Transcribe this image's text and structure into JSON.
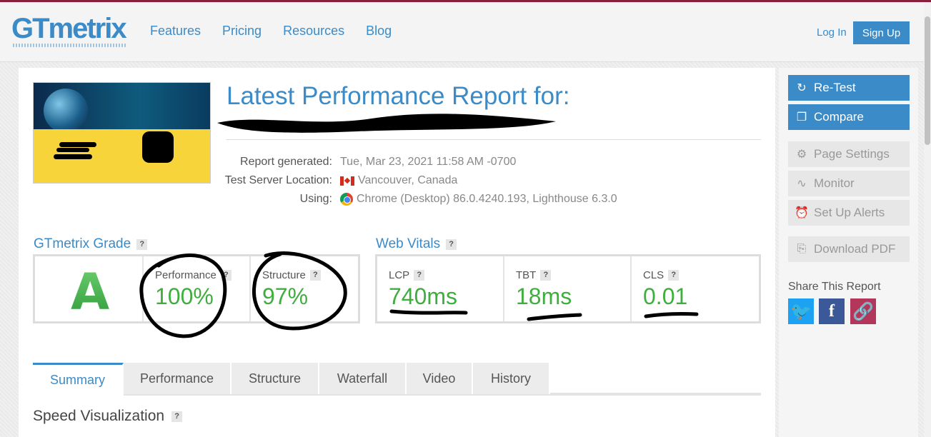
{
  "header": {
    "logo": "GTmetrix",
    "nav": [
      "Features",
      "Pricing",
      "Resources",
      "Blog"
    ],
    "login": "Log In",
    "signup": "Sign Up"
  },
  "report": {
    "title": "Latest Performance Report for:",
    "meta": [
      {
        "label": "Report generated:",
        "value": "Tue, Mar 23, 2021 11:58 AM -0700"
      },
      {
        "label": "Test Server Location:",
        "value": "Vancouver, Canada"
      },
      {
        "label": "Using:",
        "value": "Chrome (Desktop) 86.0.4240.193, Lighthouse 6.3.0"
      }
    ]
  },
  "grade": {
    "title": "GTmetrix Grade",
    "letter": "A",
    "performance_label": "Performance",
    "performance_value": "100%",
    "structure_label": "Structure",
    "structure_value": "97%"
  },
  "vitals": {
    "title": "Web Vitals",
    "items": [
      {
        "label": "LCP",
        "value": "740ms"
      },
      {
        "label": "TBT",
        "value": "18ms"
      },
      {
        "label": "CLS",
        "value": "0.01"
      }
    ]
  },
  "tabs": [
    "Summary",
    "Performance",
    "Structure",
    "Waterfall",
    "Video",
    "History"
  ],
  "speed_viz": "Speed Visualization",
  "help_mark": "?",
  "sidebar": {
    "buttons": [
      "Re-Test",
      "Compare",
      "Page Settings",
      "Monitor",
      "Set Up Alerts",
      "Download PDF"
    ],
    "share_title": "Share This Report",
    "share_icons": [
      "twitter-icon",
      "facebook-icon",
      "link-icon"
    ]
  },
  "colors": {
    "accent": "#3a8bc8",
    "good": "#3fae3f",
    "twitter": "#1da1f2",
    "facebook": "#3b5998",
    "link": "#b3365b"
  }
}
